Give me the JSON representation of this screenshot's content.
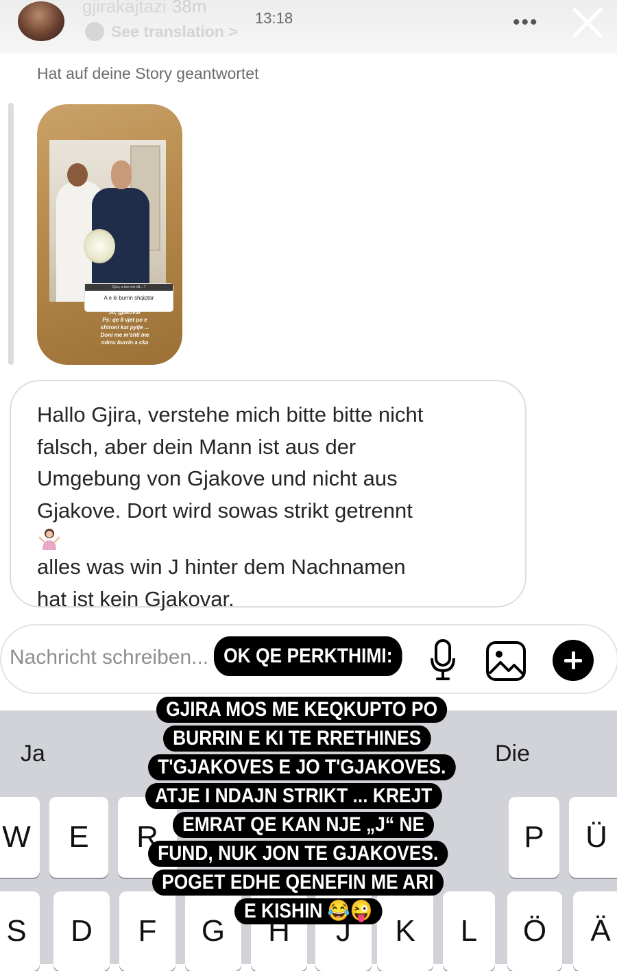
{
  "header": {
    "username": "gjirakajtazi",
    "age": "38m",
    "clock": "13:18",
    "see_translation": "See translation >",
    "more_label": "•••"
  },
  "thread": {
    "replied_label": "Hat auf deine Story geantwortet",
    "story": {
      "question": "Gjira, a ken me dit... ?",
      "question_text": "A e ki burrin shqiptar",
      "answer_lines": [
        "Jo, gjakovar",
        "Ps: qe 8 vjet po e",
        "shtroni kat pytje ...",
        "Doni me m'shti me",
        "ndrru burrin a cka"
      ]
    },
    "message_lines": [
      "Hallo Gjira, verstehe mich bitte bitte nicht",
      "falsch, aber dein Mann ist aus der",
      "Umgebung von Gjakove und nicht aus",
      "Gjakove. Dort wird sowas strikt getrennt",
      "alles was win J hinter dem Nachnamen",
      "hat ist kein Gjakovar."
    ]
  },
  "composer": {
    "placeholder": "Nachricht schreiben..."
  },
  "keyboard": {
    "suggestions": [
      "Ja",
      "Die"
    ],
    "row1": [
      "W",
      "E",
      "R",
      "P",
      "Ü"
    ],
    "row2": [
      "S",
      "D",
      "F",
      "G",
      "H",
      "J",
      "K",
      "L",
      "Ö",
      "Ä"
    ]
  },
  "caption": {
    "title": "OK QE PERKTHIMI:",
    "lines": [
      "GJIRA MOS ME KEQKUPTO PO",
      "BURRIN E KI TE RRETHINES",
      "T'GJAKOVES E JO T'GJAKOVES.",
      "ATJE I NDAJN STRIKT ... KREJT",
      "EMRAT QE KAN NJE „J“ NE",
      "FUND, NUK JON TE GJAKOVES.",
      "POGET EDHE QENEFIN ME ARI",
      "E KISHIN 😂😜"
    ]
  },
  "icons": {
    "more": "more-dots-icon",
    "close": "close-icon",
    "mic": "microphone-icon",
    "gallery": "gallery-icon",
    "plus": "plus-icon",
    "shrug": "person-shrugging-emoji"
  }
}
